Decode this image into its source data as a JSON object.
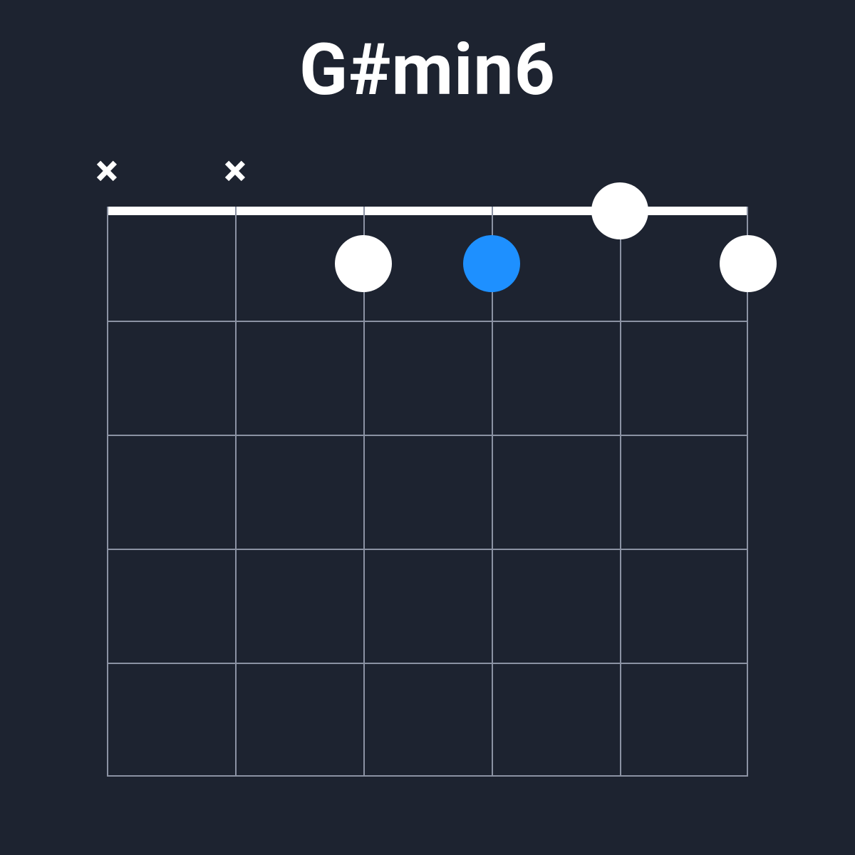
{
  "chord": {
    "name": "G#min6",
    "num_strings": 6,
    "num_frets": 5,
    "colors": {
      "background": "#1d2330",
      "grid": "#8b92a3",
      "nut": "#ffffff",
      "dot_default": "#ffffff",
      "dot_root": "#1e90ff",
      "text": "#ffffff"
    },
    "string_markers": [
      {
        "string": 1,
        "symbol": "×"
      },
      {
        "string": 2,
        "symbol": "×"
      }
    ],
    "dots": [
      {
        "string": 3,
        "fret": 1,
        "color": "white"
      },
      {
        "string": 4,
        "fret": 1,
        "color": "blue"
      },
      {
        "string": 5,
        "fret": 0,
        "color": "white"
      },
      {
        "string": 6,
        "fret": 1,
        "color": "white"
      }
    ]
  }
}
